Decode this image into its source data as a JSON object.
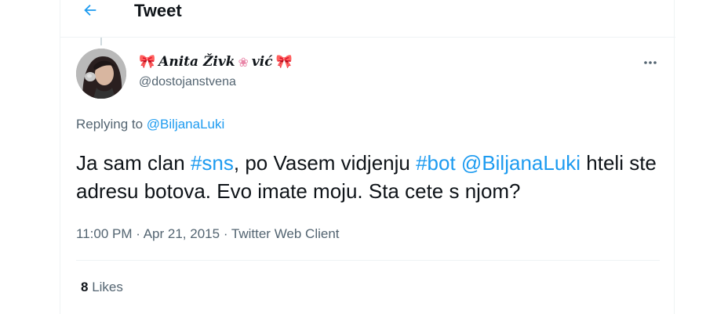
{
  "header": {
    "title": "Tweet",
    "back_icon": "arrow-left-icon"
  },
  "colors": {
    "accent": "#1d9bf0",
    "secondary_text": "#536471",
    "primary_text": "#0f1419"
  },
  "tweet": {
    "display_name_parts": [
      "Anita Živk",
      "vić"
    ],
    "name_emoji": {
      "left": "ribbon-icon",
      "middle": "flower-icon",
      "right": "ribbon-icon"
    },
    "handle": "@dostojanstvena",
    "more_icon": "ellipsis-icon",
    "replying_prefix": "Replying to",
    "replying_to": "@BiljanaLuki",
    "text_parts": [
      "Ja sam clan ",
      "#sns",
      ", po Vasem vidjenju ",
      "#bot",
      " ",
      "@BiljanaLuki",
      " hteli ste adresu botova. Evo imate moju. Sta cete s njom?"
    ],
    "time": "11:00 PM",
    "date": "Apr 21, 2015",
    "separator": "·",
    "client": "Twitter Web Client",
    "likes_count": "8",
    "likes_label": "Likes"
  }
}
